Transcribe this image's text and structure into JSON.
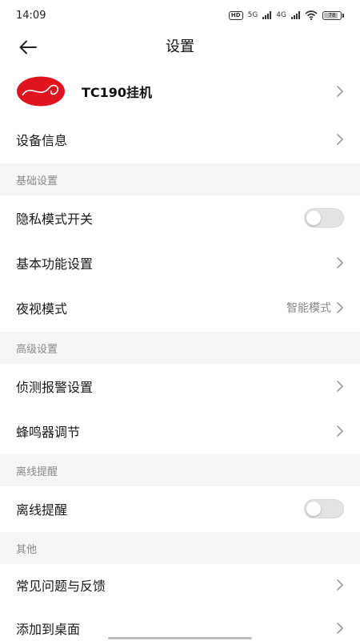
{
  "status_bar": {
    "time": "14:09",
    "hd_label": "HD",
    "net1": "5G",
    "net2": "4G",
    "battery": "78"
  },
  "app_bar": {
    "title": "设置"
  },
  "device": {
    "name": "TC190挂机"
  },
  "rows": {
    "device_info": "设备信息",
    "privacy_mode": "隐私模式开关",
    "basic_function": "基本功能设置",
    "night_vision": "夜视模式",
    "night_vision_value": "智能模式",
    "detection_alarm": "侦测报警设置",
    "buzzer": "蜂鸣器调节",
    "offline_reminder": "离线提醒",
    "faq_feedback": "常见问题与反馈",
    "add_to_desktop": "添加到桌面"
  },
  "sections": {
    "basic": "基础设置",
    "advanced": "高级设置",
    "offline": "离线提醒",
    "other": "其他"
  },
  "toggles": {
    "privacy_mode_on": false,
    "offline_reminder_on": false
  },
  "colors": {
    "logo_red": "#e0141e",
    "section_bg": "#f5f5f5",
    "secondary_text": "#8a8a8a",
    "toggle_off": "#e3e3e3"
  }
}
